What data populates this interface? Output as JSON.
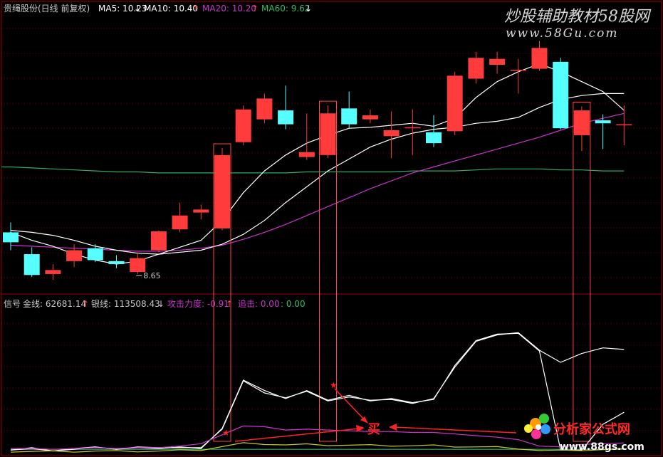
{
  "colors": {
    "background": "#000000",
    "up": "#ff3b3b",
    "down": "#55ffff",
    "ma5": "#ffffff",
    "ma10": "#ffffff",
    "ma20": "#cc33cc",
    "ma60": "#33aa66",
    "grid": "#7a0000",
    "frame": "#a00000",
    "signal_box": "#ff4444",
    "arrow": "#ff2222",
    "gold_line": "#ffffff",
    "silver_line": "#ffffff",
    "text": "#c8c8c8",
    "ma20_label": "#cc33cc",
    "ma60_label": "#33bb66",
    "attack_label": "#cc33cc",
    "chase_label": "#cc33cc",
    "chase_value": "#33bb66"
  },
  "header": {
    "stock": "贵绳股份(日线 前复权)",
    "ma5_label": "MA5: 10.23",
    "ma5_arrow": "↓",
    "ma10_label": "MA10: 10.40",
    "ma10_arrow": "↑",
    "ma20_label": "MA20: 10.20",
    "ma20_arrow": "↑",
    "ma60_label": "MA60: 9.62",
    "ma60_arrow": "↓"
  },
  "indicator_header": {
    "name": "信号",
    "gold_label": "金线: 62681.14",
    "gold_arrow": "↑",
    "silver_label": "银线: 113508.43",
    "silver_arrow": "↓",
    "attack_label": "攻击力度: -0.91",
    "attack_arrow": "↑",
    "chase_label": "追击: 0.00",
    "chase_value": ": 0.00"
  },
  "watermark": {
    "line1": "炒股辅助教材58股网",
    "line2": "www.58Gu.com"
  },
  "logo": {
    "name": "分析家公式网",
    "url": "www.88gs.com"
  },
  "annotations": {
    "low_price": "8.65",
    "buy_label": "买",
    "star": "★"
  },
  "chart_data": [
    {
      "type": "candlestick",
      "title": "贵绳股份(日线 前复权)",
      "candles": [
        {
          "o": 9.0,
          "h": 9.1,
          "l": 8.82,
          "c": 8.9
        },
        {
          "o": 8.78,
          "h": 8.85,
          "l": 8.55,
          "c": 8.57
        },
        {
          "o": 8.58,
          "h": 8.68,
          "l": 8.52,
          "c": 8.62
        },
        {
          "o": 8.71,
          "h": 8.88,
          "l": 8.65,
          "c": 8.82
        },
        {
          "o": 8.84,
          "h": 8.88,
          "l": 8.7,
          "c": 8.72
        },
        {
          "o": 8.71,
          "h": 8.77,
          "l": 8.64,
          "c": 8.68
        },
        {
          "o": 8.6,
          "h": 8.8,
          "l": 8.58,
          "c": 8.74
        },
        {
          "o": 8.82,
          "h": 9.02,
          "l": 8.8,
          "c": 9.01
        },
        {
          "o": 9.03,
          "h": 9.3,
          "l": 9.0,
          "c": 9.17
        },
        {
          "o": 9.2,
          "h": 9.28,
          "l": 9.13,
          "c": 9.23
        },
        {
          "o": 9.04,
          "h": 9.85,
          "l": 9.02,
          "c": 9.78
        },
        {
          "o": 9.91,
          "h": 10.28,
          "l": 9.88,
          "c": 10.24
        },
        {
          "o": 10.14,
          "h": 10.4,
          "l": 10.1,
          "c": 10.35
        },
        {
          "o": 10.23,
          "h": 10.48,
          "l": 10.04,
          "c": 10.09
        },
        {
          "o": 9.76,
          "h": 10.2,
          "l": 9.73,
          "c": 9.81
        },
        {
          "o": 9.78,
          "h": 10.28,
          "l": 9.75,
          "c": 10.2
        },
        {
          "o": 10.25,
          "h": 10.42,
          "l": 10.05,
          "c": 10.09
        },
        {
          "o": 10.14,
          "h": 10.24,
          "l": 10.1,
          "c": 10.18
        },
        {
          "o": 9.97,
          "h": 10.22,
          "l": 9.75,
          "c": 10.03
        },
        {
          "o": 10.05,
          "h": 10.24,
          "l": 9.78,
          "c": 10.06
        },
        {
          "o": 10.01,
          "h": 10.18,
          "l": 9.86,
          "c": 9.9
        },
        {
          "o": 10.02,
          "h": 10.62,
          "l": 9.98,
          "c": 10.58
        },
        {
          "o": 10.55,
          "h": 10.82,
          "l": 10.5,
          "c": 10.76
        },
        {
          "o": 10.69,
          "h": 10.82,
          "l": 10.6,
          "c": 10.75
        },
        {
          "o": 10.63,
          "h": 10.75,
          "l": 10.4,
          "c": 10.64
        },
        {
          "o": 10.65,
          "h": 10.93,
          "l": 10.63,
          "c": 10.86
        },
        {
          "o": 10.72,
          "h": 10.76,
          "l": 10.04,
          "c": 10.05
        },
        {
          "o": 9.98,
          "h": 10.27,
          "l": 9.82,
          "c": 10.23
        },
        {
          "o": 10.13,
          "h": 10.19,
          "l": 9.84,
          "c": 10.1
        },
        {
          "o": 10.09,
          "h": 10.28,
          "l": 9.88,
          "c": 10.09
        }
      ],
      "ma5": [
        9.0,
        8.92,
        8.86,
        8.78,
        8.72,
        8.68,
        8.71,
        8.78,
        8.85,
        8.92,
        9.12,
        9.4,
        9.62,
        9.78,
        9.9,
        9.98,
        10.05,
        10.06,
        10.08,
        10.1,
        10.07,
        10.15,
        10.36,
        10.52,
        10.62,
        10.7,
        10.62,
        10.52,
        10.42,
        10.23
      ],
      "ma10": [
        9.02,
        9.0,
        8.97,
        8.92,
        8.86,
        8.82,
        8.79,
        8.78,
        8.8,
        8.82,
        8.88,
        8.98,
        9.12,
        9.3,
        9.46,
        9.62,
        9.74,
        9.86,
        9.94,
        10.0,
        10.04,
        10.06,
        10.1,
        10.12,
        10.16,
        10.26,
        10.34,
        10.38,
        10.4,
        10.4
      ],
      "ma20": [
        8.87,
        8.86,
        8.85,
        8.84,
        8.83,
        8.82,
        8.81,
        8.81,
        8.82,
        8.84,
        8.87,
        8.93,
        9.0,
        9.08,
        9.17,
        9.26,
        9.35,
        9.44,
        9.52,
        9.6,
        9.66,
        9.72,
        9.78,
        9.84,
        9.9,
        9.96,
        10.03,
        10.1,
        10.15,
        10.2
      ],
      "ma60": [
        9.66,
        9.65,
        9.64,
        9.63,
        9.62,
        9.61,
        9.61,
        9.6,
        9.6,
        9.6,
        9.6,
        9.6,
        9.6,
        9.6,
        9.61,
        9.61,
        9.61,
        9.61,
        9.61,
        9.62,
        9.62,
        9.62,
        9.63,
        9.64,
        9.64,
        9.64,
        9.63,
        9.63,
        9.62,
        9.62
      ],
      "yrange": [
        8.4,
        11.2
      ],
      "signal_days": [
        10,
        15,
        27
      ],
      "low_marker": {
        "day": 6,
        "value": 8.65
      }
    },
    {
      "type": "line",
      "title": "信号",
      "series": [
        {
          "name": "金线",
          "values": [
            6,
            6,
            6,
            6,
            6,
            6,
            6,
            6,
            6,
            6,
            6,
            6,
            6,
            6,
            6,
            6,
            6,
            6,
            6,
            6,
            6,
            6,
            6,
            6,
            6,
            6,
            6,
            6,
            6,
            6
          ]
        },
        {
          "name": "银线",
          "values": [
            5,
            7,
            4,
            6,
            9,
            6,
            8,
            7,
            9,
            7,
            32,
            92,
            79,
            69,
            79,
            67,
            73,
            66,
            69,
            64,
            68,
            110,
            141,
            149,
            150,
            128,
            5,
            5,
            37,
            52
          ]
        }
      ],
      "extra_lines": [
        {
          "values": [
            5,
            8,
            4,
            7,
            9,
            6,
            9,
            8,
            8,
            8,
            31,
            91,
            76,
            70,
            78,
            66,
            71,
            67,
            68,
            63,
            69,
            108,
            140,
            148,
            151,
            129,
            114,
            125,
            132,
            130
          ]
        },
        {
          "values": [
            7,
            7,
            6,
            7,
            8,
            7,
            8,
            8,
            10,
            13,
            24,
            35,
            34,
            30,
            31,
            30,
            29,
            28,
            28,
            27,
            27,
            25,
            23,
            21,
            18,
            10,
            9,
            12,
            13,
            14
          ]
        }
      ],
      "yrange": [
        0,
        175
      ]
    }
  ]
}
